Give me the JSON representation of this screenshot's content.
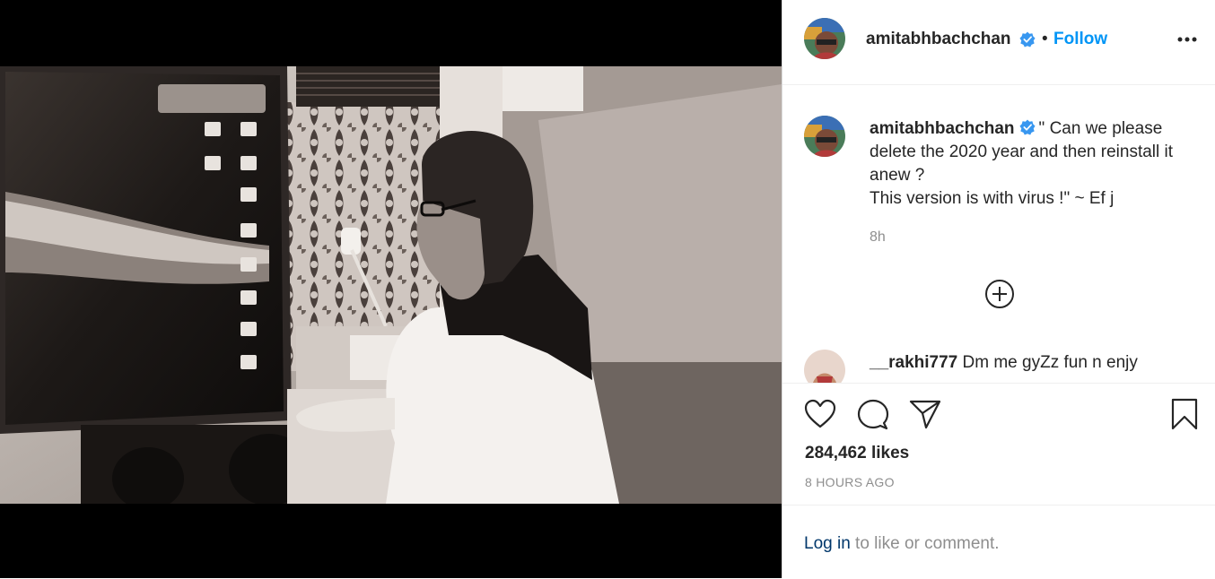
{
  "post": {
    "username": "amitabhbachchan",
    "separator": "•",
    "follow_label": "Follow",
    "caption": "\" Can we please delete the 2020 year and then reinstall it anew ?",
    "caption_line2": "This version is with virus !\" ~ Ef j",
    "time_short": "8h",
    "likes": "284,462 likes",
    "time_ago": "8 HOURS AGO"
  },
  "comments": [
    {
      "username": "__rakhi777",
      "text": "Dm me gyZz fun n enjy"
    }
  ],
  "footer": {
    "login_link": "Log in",
    "login_text": " to like or comment."
  },
  "colors": {
    "accent": "#0095f6",
    "verified": "#3897f0",
    "muted": "#8e8e8e",
    "link": "#00376b"
  },
  "icons": [
    "heart-icon",
    "comment-icon",
    "share-icon",
    "bookmark-icon",
    "more-options-icon",
    "load-more-icon",
    "verified-badge-icon"
  ]
}
